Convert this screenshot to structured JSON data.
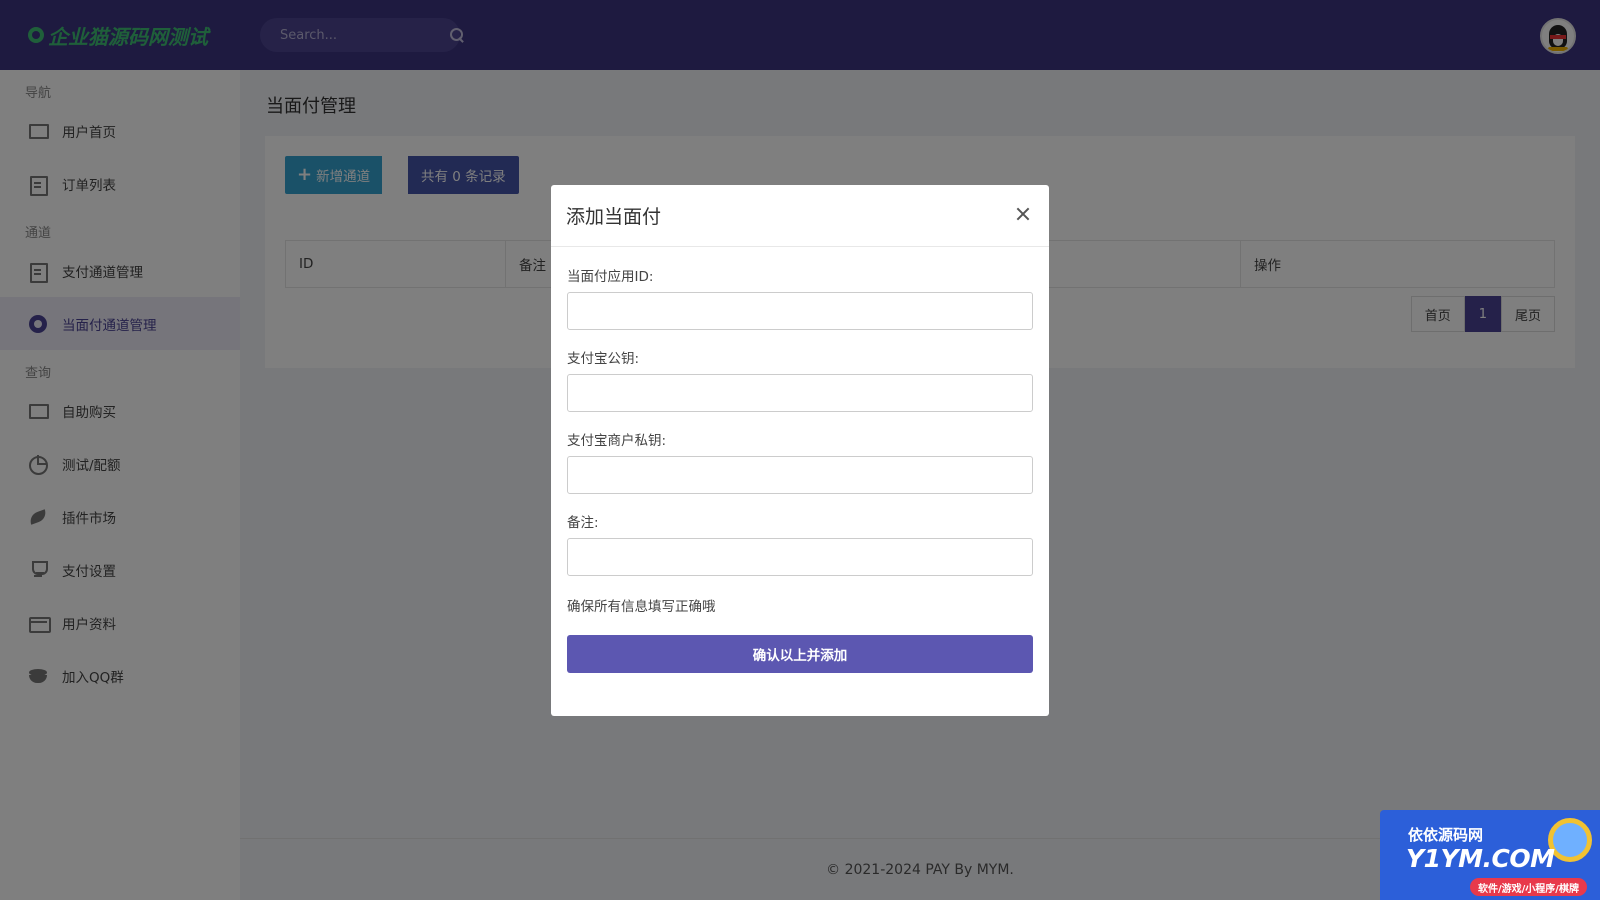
{
  "header": {
    "logo_text": "企业猫源码网测试",
    "search_placeholder": "Search..."
  },
  "sidebar": {
    "sections": [
      {
        "title": "导航",
        "items": [
          {
            "label": "用户首页",
            "icon": "monitor-icon"
          },
          {
            "label": "订单列表",
            "icon": "clipboard-icon"
          }
        ]
      },
      {
        "title": "通道",
        "items": [
          {
            "label": "支付通道管理",
            "icon": "clipboard-icon"
          },
          {
            "label": "当面付通道管理",
            "icon": "lifebuoy-icon",
            "active": true
          }
        ]
      },
      {
        "title": "查询",
        "items": [
          {
            "label": "自助购买",
            "icon": "monitor-icon"
          },
          {
            "label": "测试/配额",
            "icon": "pie-chart-icon"
          },
          {
            "label": "插件市场",
            "icon": "leaf-icon"
          },
          {
            "label": "支付设置",
            "icon": "trophy-icon"
          },
          {
            "label": "用户资料",
            "icon": "credit-card-icon"
          },
          {
            "label": "加入QQ群",
            "icon": "database-icon"
          }
        ]
      }
    ]
  },
  "main": {
    "page_title": "当面付管理",
    "add_button": "新增通道",
    "record_count": "共有 0 条记录",
    "table_headers": [
      "ID",
      "备注",
      "",
      "操作"
    ],
    "pagination": {
      "first": "首页",
      "current": "1",
      "last": "尾页"
    },
    "footer": "© 2021-2024 PAY By MYM."
  },
  "modal": {
    "title": "添加当面付",
    "fields": [
      {
        "label": "当面付应用ID:",
        "value": ""
      },
      {
        "label": "支付宝公钥:",
        "value": ""
      },
      {
        "label": "支付宝商户私钥:",
        "value": ""
      },
      {
        "label": "备注:",
        "value": ""
      }
    ],
    "note": "确保所有信息填写正确哦",
    "submit": "确认以上并添加"
  },
  "watermark": {
    "line1": "依依源码网",
    "line2": "Y1YM.COM",
    "line3": "软件/游戏/小程序/棋牌"
  },
  "colors": {
    "header_bg": "#3d3580",
    "accent": "#4a4394",
    "add_button": "#35a3d1",
    "count_button": "#4454a8",
    "submit_button": "#5c57b1",
    "logo": "#3fbf74"
  }
}
